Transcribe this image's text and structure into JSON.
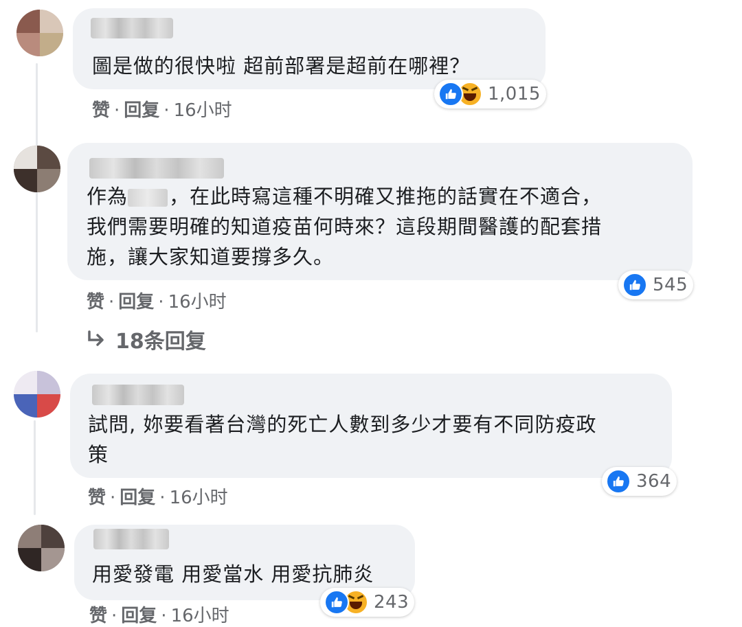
{
  "comments": [
    {
      "text_lines": [
        "圖是做的很快啦 超前部署是超前在哪裡？"
      ],
      "reactions": [
        "like",
        "haha"
      ],
      "reaction_count": "1,015",
      "like_label": "赞",
      "reply_label": "回复",
      "time": "16小时"
    },
    {
      "text_lines": [
        "，在此時寫這種不明確又推拖的話實在不適合，",
        "我們需要明確的知道疫苗何時來？這段期間醫護的配套措",
        "施，讓大家知道要撐多久。"
      ],
      "text_prefix": "作為",
      "reactions": [
        "like"
      ],
      "reaction_count": "545",
      "like_label": "赞",
      "reply_label": "回复",
      "time": "16小时",
      "replies_link": "18条回复"
    },
    {
      "text_lines": [
        "試問, 妳要看著台灣的死亡人數到多少才要有不同防疫政",
        "策"
      ],
      "reactions": [
        "like"
      ],
      "reaction_count": "364",
      "like_label": "赞",
      "reply_label": "回复",
      "time": "16小时"
    },
    {
      "text_lines": [
        "用愛發電 用愛當水 用愛抗肺炎"
      ],
      "reactions": [
        "like",
        "haha"
      ],
      "reaction_count": "243",
      "like_label": "赞",
      "reply_label": "回复",
      "time": "16小时"
    }
  ],
  "icons": {
    "like": "thumbs-up-icon",
    "haha": "laughing-face-icon",
    "reply_arrow": "reply-arrow-icon"
  },
  "colors": {
    "bubble": "#f0f2f5",
    "like_blue": "#1877f2",
    "haha_yellow": "#f7b125",
    "meta_gray": "#65676b"
  }
}
